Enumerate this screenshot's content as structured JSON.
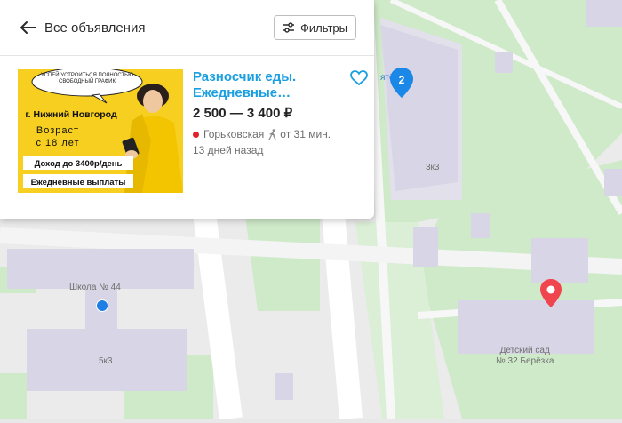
{
  "header": {
    "back_label": "Все объявления",
    "filters_label": "Фильтры"
  },
  "listing": {
    "title": "Разносчик еды. Ежедневные…",
    "price": "2 500 — 3 400 ₽",
    "metro": "Горьковская",
    "walk_time": "от 31 мин.",
    "posted": "13 дней назад",
    "metro_color": "#e0222c"
  },
  "ad_image": {
    "bubble": "УСПЕЙ УСТРОИТЬСЯ ПОЛНОСТЬЮ СВОБОДНЫЙ ГРАФИК",
    "city": "г. Нижний Новгород",
    "age_line1": "Возраст",
    "age_line2": "с 18 лет",
    "income": "Доход до 3400р/день",
    "payouts": "Ежедневные выплаты",
    "background_color": "#f6cf20"
  },
  "map": {
    "labels": {
      "school": "Школа № 44",
      "building_5k3": "5к3",
      "building_3k3": "3к3",
      "kindergarten_line1": "Детский сад",
      "kindergarten_line2": "№ 32 Берёзка",
      "shop": "ятёр"
    },
    "cluster_count": "2",
    "colors": {
      "park": "#c9e8c4",
      "building": "#d8d6e6",
      "road": "#ffffff",
      "cluster_pin": "#1b87e6",
      "selected_pin": "#f0454f"
    }
  }
}
